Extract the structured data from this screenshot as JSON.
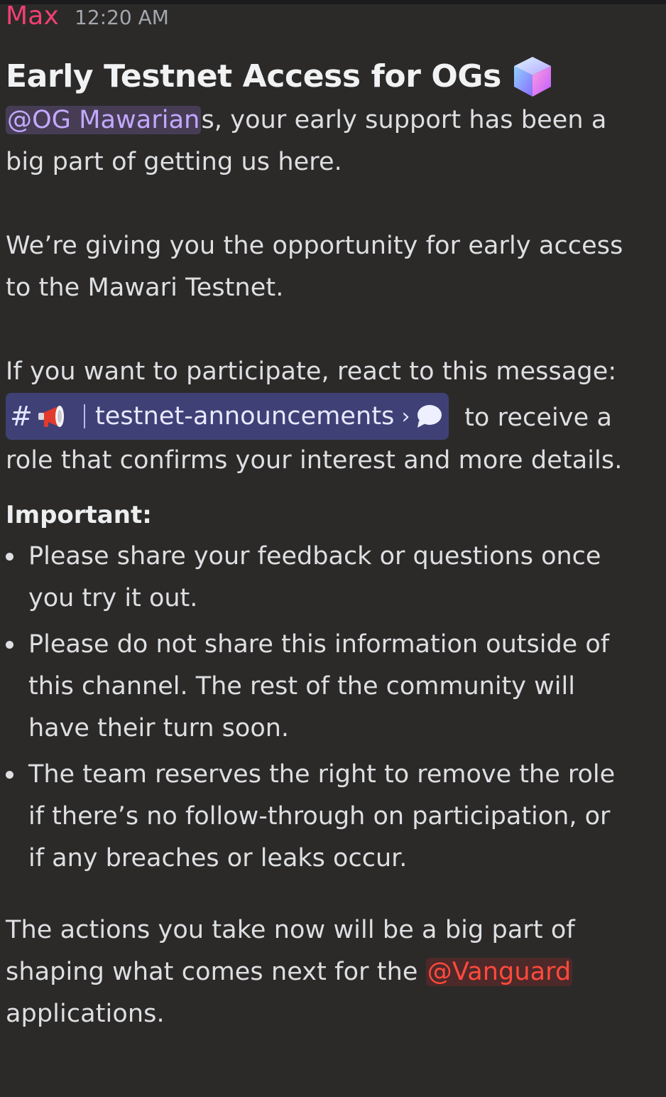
{
  "message": {
    "author": "Max",
    "timestamp": "12:20 AM",
    "title": "Early Testnet Access for OGs",
    "title_emoji": "cube-icon",
    "p1": {
      "mention": "@OG Mawarian",
      "rest_line1": "s, your early support has been a",
      "line2": "big part of getting us here."
    },
    "p2": {
      "line1": "We’re giving you the opportunity for early access",
      "line2": "to the Mawari Testnet."
    },
    "p3": {
      "line1": "If you want to participate, react to this message:",
      "channel": {
        "hash": "#",
        "name": "testnet-announcements",
        "chevron": "›"
      },
      "after_channel": "to receive a",
      "line3": "role that confirms your interest and more details."
    },
    "important_label": "Important:",
    "bullets": [
      {
        "line1": "Please share your feedback or questions once",
        "line2": "you try it out."
      },
      {
        "line1": "Please do not share this information outside of",
        "line2": "this channel. The rest of the community will",
        "line3": "have their turn soon."
      },
      {
        "line1": "The team reserves the right to remove the role",
        "line2": "if there’s no follow-through on participation, or",
        "line3": "if any breaches or leaks occur."
      }
    ],
    "closing": {
      "line1": "The actions you take now will be a big part of",
      "line2_before": "shaping what comes next for the ",
      "mention": "@Vanguard",
      "line3": "applications."
    }
  },
  "colors": {
    "background": "#2b2a29",
    "author": "#f23f72",
    "role_mention": "#c4a8ff",
    "red_mention": "#ff4a3d",
    "channel_pill": "#3f4176"
  }
}
